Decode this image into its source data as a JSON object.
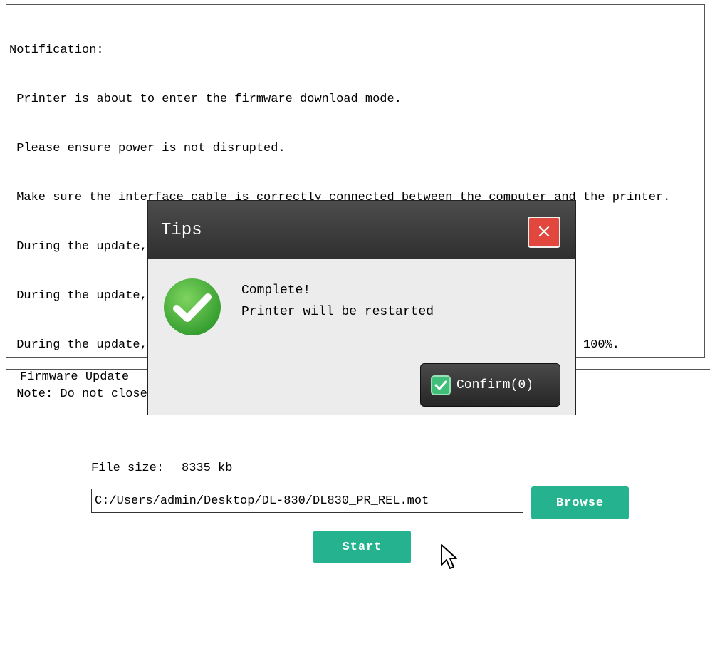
{
  "notification": {
    "lines": [
      "Notification:",
      " Printer is about to enter the firmware download mode.",
      " Please ensure power is not disrupted.",
      " Make sure the interface cable is correctly connected between the computer and the printer.",
      " During the update, do not power off the printer.",
      " During the update, please stop all the printing tasks.",
      " During the update, please wait patiently, until the download progress reaches 100%.",
      " Note: Do not close page during download!"
    ]
  },
  "firmware_update": {
    "legend": "Firmware Update",
    "file_size_label": "File size:",
    "file_size_value": "8335 kb",
    "file_path": "C:/Users/admin/Desktop/DL-830/DL830_PR_REL.mot",
    "browse_label": "Browse",
    "start_label": "Start"
  },
  "dialog": {
    "title": "Tips",
    "close_glyph": "×",
    "message_line1": "Complete!",
    "message_line2": "Printer will be restarted",
    "confirm_label": "Confirm(0)",
    "icon": "success-check-icon"
  },
  "colors": {
    "accent_green": "#25b38f",
    "success_green": "#3fa73a",
    "close_red": "#e2473d",
    "titlebar_dark": "#3a3a3a"
  }
}
